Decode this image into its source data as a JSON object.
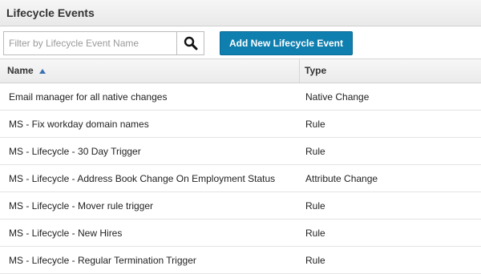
{
  "header": {
    "title": "Lifecycle Events"
  },
  "toolbar": {
    "search_placeholder": "Filter by Lifecycle Event Name",
    "search_value": "",
    "add_button_label": "Add New Lifecycle Event",
    "search_icon": "search-icon"
  },
  "table": {
    "columns": [
      {
        "label": "Name",
        "sort": "ascending"
      },
      {
        "label": "Type"
      }
    ],
    "rows": [
      {
        "name": "Email manager for all native changes",
        "type": "Native Change"
      },
      {
        "name": "MS - Fix workday domain names",
        "type": "Rule"
      },
      {
        "name": "MS - Lifecycle - 30 Day Trigger",
        "type": "Rule"
      },
      {
        "name": "MS - Lifecycle - Address Book Change On Employment Status",
        "type": "Attribute Change"
      },
      {
        "name": "MS - Lifecycle - Mover rule trigger",
        "type": "Rule"
      },
      {
        "name": "MS - Lifecycle - New Hires",
        "type": "Rule"
      },
      {
        "name": "MS - Lifecycle - Regular Termination Trigger",
        "type": "Rule"
      }
    ]
  },
  "colors": {
    "accent": "#0f7fb0",
    "header_bg": "#eeeeee",
    "border": "#d6d6d6"
  }
}
